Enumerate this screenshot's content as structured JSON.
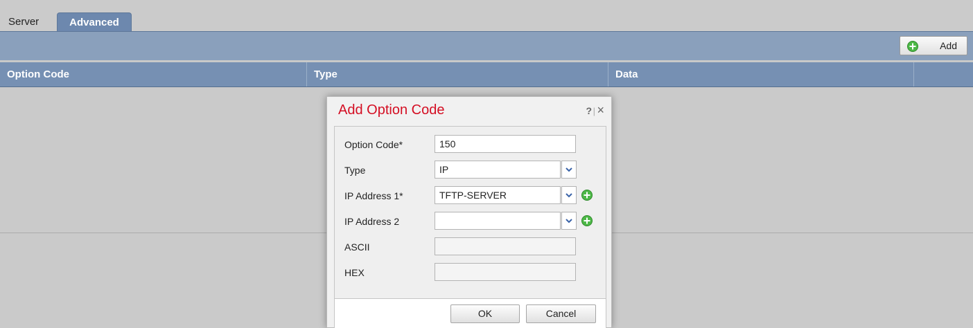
{
  "tabs": {
    "server": "Server",
    "advanced": "Advanced"
  },
  "toolbar": {
    "add_label": "Add"
  },
  "grid": {
    "columns": [
      "Option Code",
      "Type",
      "Data",
      ""
    ]
  },
  "dialog": {
    "title": "Add Option Code",
    "help": "?",
    "separator": "|",
    "close": "×",
    "fields": {
      "option_code": {
        "label": "Option Code*",
        "value": "150"
      },
      "type": {
        "label": "Type",
        "value": "IP"
      },
      "ip1": {
        "label": "IP Address 1*",
        "value": "TFTP-SERVER"
      },
      "ip2": {
        "label": "IP Address 2",
        "value": ""
      },
      "ascii": {
        "label": "ASCII",
        "value": ""
      },
      "hex": {
        "label": "HEX",
        "value": ""
      }
    },
    "ok_label": "OK",
    "cancel_label": "Cancel"
  },
  "colors": {
    "accent": "#6d88ae",
    "title_red": "#d40e23",
    "add_green": "#4db847"
  }
}
